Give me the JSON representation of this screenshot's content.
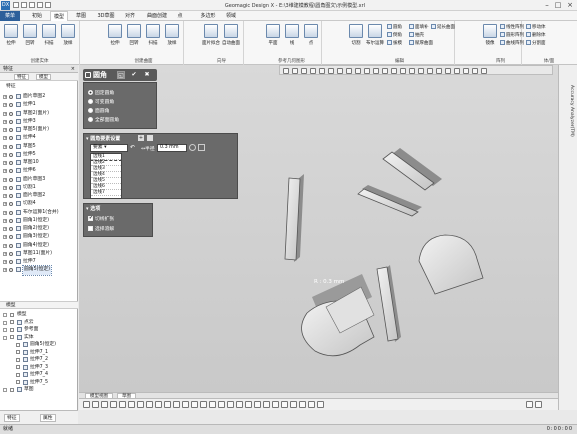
{
  "app": {
    "title": "Geomagic Design X - E:\\3维建模教程\\圆角图文\\示例模型.xrl",
    "logo": "DX"
  },
  "tabs": [
    {
      "label": "菜单"
    },
    {
      "label": "初始"
    },
    {
      "label": "模型"
    },
    {
      "label": "草图"
    },
    {
      "label": "3D草图"
    },
    {
      "label": "对齐"
    },
    {
      "label": "曲面创建"
    },
    {
      "label": "点"
    },
    {
      "label": "多边形"
    },
    {
      "label": "领域"
    }
  ],
  "ribbon": {
    "groups": [
      {
        "label": "创建实体",
        "buttons": [
          "拉伸",
          "回转",
          "扫描",
          "放样"
        ]
      },
      {
        "label": "创建曲面",
        "buttons": [
          "拉伸",
          "回转",
          "扫描",
          "放样"
        ]
      },
      {
        "label": "向导",
        "buttons": [
          "面片拟合",
          "自动曲面"
        ]
      },
      {
        "label": "参考几何图形",
        "buttons": [
          "平面",
          "线",
          "点"
        ]
      },
      {
        "label": "编辑",
        "buttons": [
          "切割",
          "布尔运算"
        ],
        "small": [
          "圆角",
          "倒角",
          "拔模",
          "面填补",
          "抽壳",
          "赋厚曲面",
          "延长曲面",
          "剪切曲面"
        ]
      },
      {
        "label": "",
        "buttons": [
          "剪切曲面",
          "缝合曲面",
          "缝合"
        ]
      },
      {
        "label": "阵列",
        "buttons": [
          "镜像"
        ],
        "small": [
          "线性阵列",
          "圆形阵列",
          "曲线阵列"
        ]
      },
      {
        "label": "体/面",
        "small": [
          "移动体",
          "删除体",
          "分割面"
        ]
      }
    ]
  },
  "left_panel": {
    "title": "特征",
    "tabs": [
      "特征",
      "模型"
    ],
    "section_label": "特征",
    "features": [
      {
        "label": "面片草图2"
      },
      {
        "label": "拉伸1"
      },
      {
        "label": "草图2(面片)"
      },
      {
        "label": "拉伸3"
      },
      {
        "label": "草图5(面片)"
      },
      {
        "label": "拉伸4"
      },
      {
        "label": "草图5"
      },
      {
        "label": "拉伸5"
      },
      {
        "label": "草图10"
      },
      {
        "label": "拉伸6"
      },
      {
        "label": "面片草图3"
      },
      {
        "label": "切割1"
      },
      {
        "label": "面片草图2"
      },
      {
        "label": "切割4"
      },
      {
        "label": "布尔运算1(合并)"
      },
      {
        "label": "圆角1(恒定)"
      },
      {
        "label": "圆角2(恒定)"
      },
      {
        "label": "圆角3(恒定)"
      },
      {
        "label": "圆角4(恒定)"
      },
      {
        "label": "草图11(面片)"
      },
      {
        "label": "拉伸7"
      },
      {
        "label": "圆角5(恒定)"
      }
    ],
    "model_label": "模型",
    "model_items": [
      {
        "label": "模型"
      },
      {
        "label": "点云"
      },
      {
        "label": "参考面"
      },
      {
        "label": "实体"
      },
      {
        "label": "圆角5(恒定)"
      },
      {
        "label": "拉伸7_1"
      },
      {
        "label": "拉伸7_2"
      },
      {
        "label": "拉伸7_3"
      },
      {
        "label": "拉伸7_4"
      },
      {
        "label": "拉伸7_5"
      },
      {
        "label": "草图"
      }
    ],
    "footer": [
      "特征",
      "属性"
    ]
  },
  "dialog": {
    "title": "圆角",
    "type_options": [
      "固定圆角",
      "可变圆角",
      "面圆角",
      "全部面圆角"
    ],
    "selected_type": "固定圆角",
    "section": "圆角要素设置",
    "mode_value": "要素",
    "radius_label": "半径",
    "radius_value": "0.3 mm",
    "edges": [
      "边线1",
      "边线2",
      "边线3",
      "边线4",
      "边线5",
      "边线6",
      "边线7",
      "边线8"
    ],
    "options_label": "选项",
    "opt_tangent": "切线扩张",
    "opt_tangent_checked": "✔",
    "opt_variable": "选择溶解"
  },
  "viewport": {
    "annotation": "R : 0.3 mm"
  },
  "view_tabs": [
    "模型视图",
    "草图"
  ],
  "statusbar": {
    "left": "就绪",
    "right": "0:00:00"
  },
  "colors": {
    "ribbon_tab_active": "#2d5f9a",
    "dialog_bg": "#6a6a6a",
    "viewport_bg": "#d2d2d2"
  }
}
